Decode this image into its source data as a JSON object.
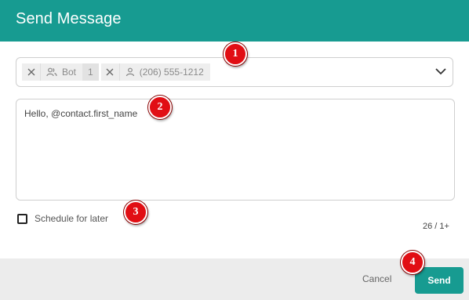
{
  "dialog": {
    "title": "Send Message"
  },
  "recipients": {
    "chips": [
      {
        "label": "Bot",
        "icon": "group-icon",
        "count": "1"
      },
      {
        "label": "(206) 555-1212",
        "icon": "person-icon"
      }
    ]
  },
  "message": {
    "text": "Hello, @contact.first_name"
  },
  "schedule": {
    "label": "Schedule for later",
    "checked": false
  },
  "counter": {
    "text": "26 / 1+"
  },
  "footer": {
    "cancel_label": "Cancel",
    "send_label": "Send"
  },
  "markers": [
    "1",
    "2",
    "3",
    "4"
  ],
  "colors": {
    "accent": "#179b91",
    "marker": "#e10e14"
  }
}
